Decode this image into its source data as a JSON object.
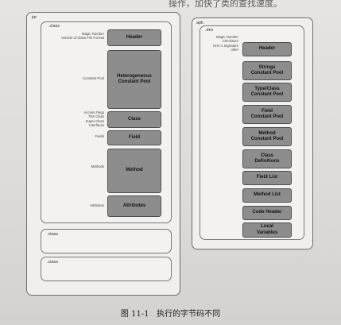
{
  "top_text": "操作，加快了类的查找速度。",
  "jar": {
    "title": "jar",
    "class_panel": {
      "title": ".class",
      "rows": [
        {
          "label": "Magic Number\nVersion of Class File Format",
          "box": "Header"
        },
        {
          "label": "Constant Pool",
          "box": "Heterogeneous\nConstant Pool"
        },
        {
          "label": "Access Flags\nThis Class\nSuper Class\nInterfaces",
          "box": "Class"
        },
        {
          "label": "Fields",
          "box": "Field"
        },
        {
          "label": "Methods",
          "box": "Method"
        },
        {
          "label": "Attributes",
          "box": "Attributes"
        }
      ]
    },
    "extra_classes": [
      ".class",
      ".class"
    ]
  },
  "apk": {
    "title": "apk",
    "dex_panel": {
      "title": ".dex",
      "label": "Magic Number\nChecksum\nSHA-1 Signature\nother",
      "boxes": [
        "Header",
        "Strings\nConstant Pool",
        "Type/Class\nConstant Pool",
        "Field\nConstant Pool",
        "Method\nConstant Pool",
        "Class\nDefinitions",
        "Field List",
        "Method List",
        "Code Header",
        "Local\nVariables"
      ]
    }
  },
  "caption": "图 11-1   执行的字节码不同"
}
